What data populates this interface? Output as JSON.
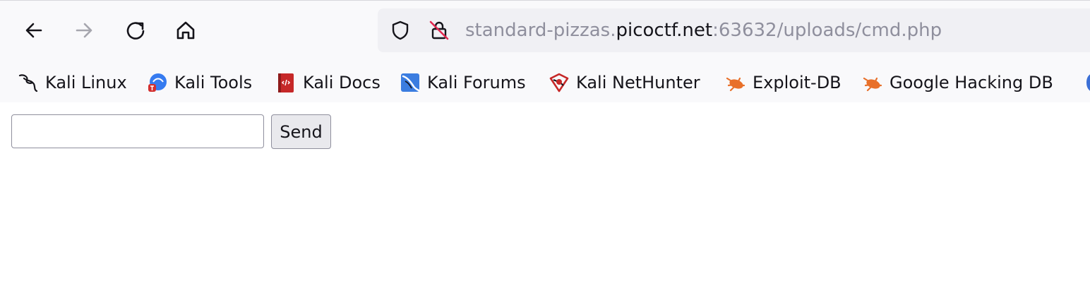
{
  "toolbar": {
    "back_icon": "arrow-left-icon",
    "forward_icon": "arrow-right-icon",
    "reload_icon": "reload-icon",
    "home_icon": "home-icon"
  },
  "urlbar": {
    "prefix": "standard-pizzas.",
    "domain": "picoctf.net",
    "suffix": ":63632/uploads/cmd.php",
    "shield_icon": "shield-icon",
    "lock_icon": "insecure-lock-icon"
  },
  "bookmarks": [
    {
      "label": "Kali Linux",
      "icon": "kali-dragon-icon"
    },
    {
      "label": "Kali Tools",
      "icon": "kali-tools-icon"
    },
    {
      "label": "Kali Docs",
      "icon": "kali-docs-icon"
    },
    {
      "label": "Kali Forums",
      "icon": "kali-forums-icon"
    },
    {
      "label": "Kali NetHunter",
      "icon": "kali-nethunter-icon"
    },
    {
      "label": "Exploit-DB",
      "icon": "exploit-db-icon"
    },
    {
      "label": "Google Hacking DB",
      "icon": "exploit-db-icon"
    }
  ],
  "form": {
    "input_value": "",
    "send_label": "Send"
  },
  "colors": {
    "toolbar_bg": "#f9f9fb",
    "urlbar_bg": "#f0f0f4",
    "text_dim": "#8f8f9d",
    "text": "#15141a",
    "exploit_orange": "#e8702a",
    "kali_blue": "#367bf0",
    "kali_red": "#d32f2f"
  }
}
